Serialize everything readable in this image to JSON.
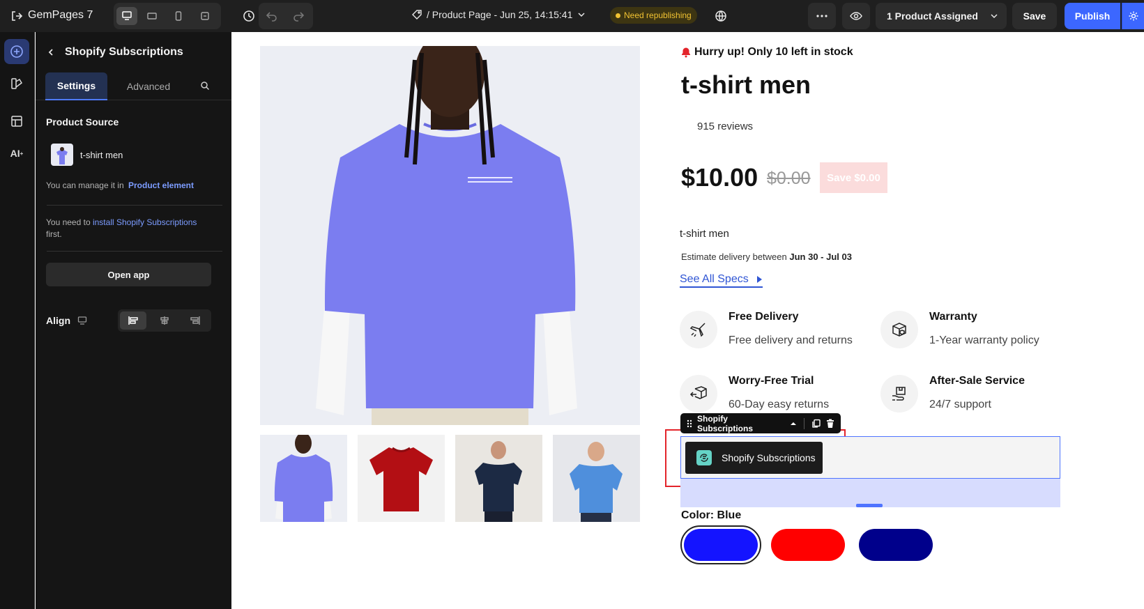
{
  "app": {
    "brand": "GemPages 7",
    "page_title": "/ Product Page - Jun 25, 14:15:41",
    "republish_badge": "Need republishing",
    "assigned": "1 Product Assigned",
    "save": "Save",
    "publish": "Publish"
  },
  "panel": {
    "title": "Shopify Subscriptions",
    "tabs": [
      "Settings",
      "Advanced"
    ],
    "product_source_label": "Product Source",
    "product_name": "t-shirt men",
    "manage_prefix": "You can manage it in",
    "manage_link": "Product element",
    "install_prefix": "You need to",
    "install_link": "install Shopify Subscriptions",
    "install_suffix": "first.",
    "open_app": "Open app",
    "align_label": "Align"
  },
  "product": {
    "stock_alert": "Hurry up! Only 10 left in stock",
    "title": "t-shirt men",
    "reviews": "915 reviews",
    "price": "$10.00",
    "compare_price": "$0.00",
    "save_badge": "Save $0.00",
    "description": "t-shirt men",
    "estimate_prefix": "Estimate delivery between",
    "estimate_dates": "Jun 30 - Jul 03",
    "see_specs": "See All Specs",
    "features": [
      {
        "title": "Free Delivery",
        "subtitle": "Free delivery and returns",
        "icon": "plane-icon"
      },
      {
        "title": "Warranty",
        "subtitle": "1-Year warranty policy",
        "icon": "box-shield-icon"
      },
      {
        "title": "Worry-Free Trial",
        "subtitle": "60-Day easy returns",
        "icon": "return-box-icon"
      },
      {
        "title": "After-Sale Service",
        "subtitle": "24/7 support",
        "icon": "hand-box-icon"
      }
    ],
    "element_toolbar": "Shopify Subscriptions",
    "subscriptions_button": "Shopify Subscriptions",
    "color_label": "Color: Blue",
    "swatches": [
      "#1414ff",
      "#ff0000",
      "#00008b"
    ],
    "tshirt_color": "#7b7df0",
    "thumb_colors": [
      "#7b7df0",
      "#b30f14",
      "#1c2a44",
      "#4f8fdc"
    ]
  },
  "colors": {
    "accent": "#3c67ff",
    "highlight": "#e3242b",
    "badge": "#f1c232"
  }
}
